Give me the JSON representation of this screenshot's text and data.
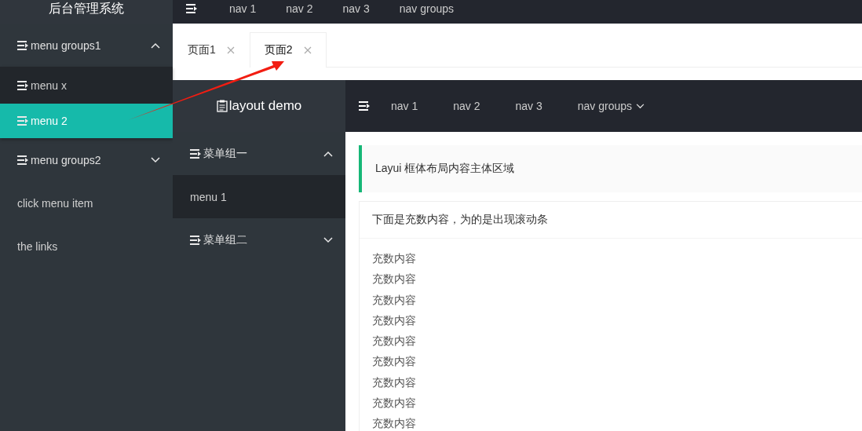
{
  "app_header": {
    "title": "后台管理系统",
    "nav": [
      {
        "label": "nav 1"
      },
      {
        "label": "nav 2"
      },
      {
        "label": "nav 3"
      },
      {
        "label": "nav groups"
      }
    ]
  },
  "sidebar": {
    "items": [
      {
        "label": "menu groups1",
        "kind": "group",
        "expanded": true,
        "children": [
          {
            "label": "menu x",
            "selected": false
          },
          {
            "label": "menu 2",
            "selected": true
          }
        ]
      },
      {
        "label": "menu groups2",
        "kind": "group",
        "expanded": false
      },
      {
        "label": "click menu item",
        "kind": "link"
      },
      {
        "label": "the links",
        "kind": "link"
      }
    ]
  },
  "tabs": [
    {
      "label": "页面1",
      "selected": false
    },
    {
      "label": "页面2",
      "selected": true
    }
  ],
  "frame": {
    "logo": "layout demo",
    "nav": [
      {
        "label": "nav 1",
        "kind": "link"
      },
      {
        "label": "nav 2",
        "kind": "link"
      },
      {
        "label": "nav 3",
        "kind": "link"
      },
      {
        "label": "nav groups",
        "kind": "dropdown"
      }
    ],
    "sidebar": [
      {
        "label": "菜单组一",
        "expanded": true,
        "children": [
          {
            "label": "menu 1"
          }
        ]
      },
      {
        "label": "菜单组二",
        "expanded": false
      }
    ],
    "quote": "Layui 框体布局内容主体区域",
    "card": {
      "header": "下面是充数内容，为的是出现滚动条",
      "rows": [
        "充数内容",
        "充数内容",
        "充数内容",
        "充数内容",
        "充数内容",
        "充数内容",
        "充数内容",
        "充数内容",
        "充数内容"
      ]
    }
  }
}
